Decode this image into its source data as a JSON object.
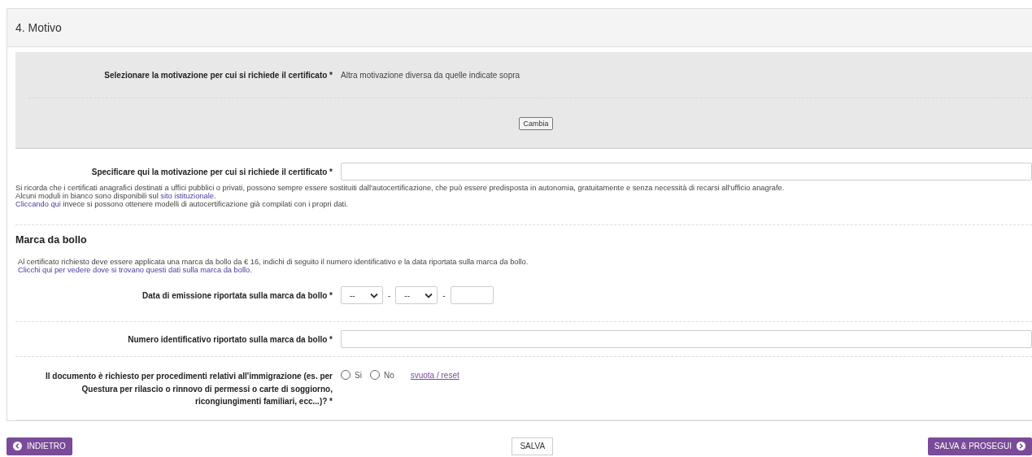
{
  "section_title": "4. Motivo",
  "motivation": {
    "label": "Selezionare la motivazione per cui si richiede il certificato *",
    "value": "Altra motivazione diversa da quelle indicate sopra",
    "change_button": "Cambia"
  },
  "specify": {
    "label": "Specificare qui la motivazione per cui si richiede il certificato *"
  },
  "notice": [
    {
      "text": "Si ricorda che i certificati anagrafici destinati a uffici pubblici o privati, possono sempre essere sostituiti dall'autocertificazione, che può essere predisposta in autonomia, gratuitamente e senza necessità di recarsi all'ufficio anagrafe."
    },
    {
      "text": "Alcuni moduli in bianco sono disponibili sul ",
      "link": "sito istituzionale",
      "after": "."
    },
    {
      "link": "Cliccando qui",
      "after": " invece si possono ottenere modelli di autocertificazione già compilati con i propri dati."
    }
  ],
  "stamp": {
    "heading": "Marca da bollo",
    "info": "Al certificato richiesto deve essere applicata una marca da bollo da € 16, indichi di seguito il numero identificativo e la data riportata sulla marca da bollo.",
    "info_link": "Clicchi qui per vedere dove si trovano questi dati sulla marca da bollo.",
    "date": {
      "label": "Data di emissione riportata sulla marca da bollo *",
      "day": "--",
      "month": "--",
      "separators": [
        "-",
        "-"
      ]
    },
    "number": {
      "label": "Numero identificativo riportato sulla marca da bollo *"
    }
  },
  "immigration": {
    "label": "Il documento è richiesto per procedimenti relativi all'immigrazione (es. per Questura per rilascio o rinnovo di permessi o carte di soggiorno, ricongiungimenti familiari, ecc...)? *",
    "options": [
      {
        "label": "Si",
        "selected": false
      },
      {
        "label": "No",
        "selected": false
      }
    ],
    "reset_link": "svuota / reset"
  },
  "footer": {
    "back": "INDIETRO",
    "save": "SALVA",
    "next": "SALVA & PROSEGUI"
  }
}
